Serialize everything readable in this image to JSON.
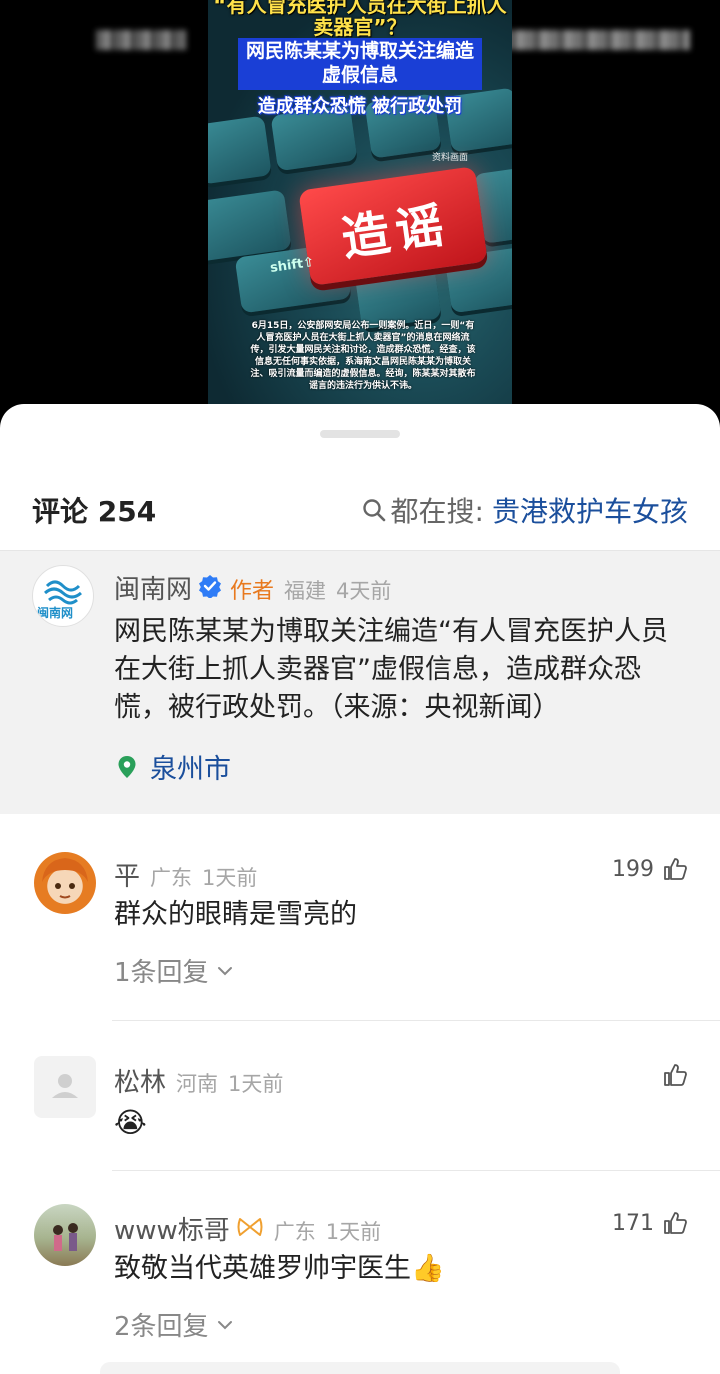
{
  "video": {
    "headline_top": "“有人冒充医护人员在大街上抓人卖器官”？",
    "headline_box": "网民陈某某为博取关注编造虚假信息",
    "headline_bottom": "造成群众恐慌 被行政处罚",
    "key_label": "造谣",
    "shift_label": "shift⇧",
    "watermark": "资料画面",
    "body_text": "6月15日，公安部网安局公布一则案例。近日，一则“有人冒充医护人员在大街上抓人卖器官”的消息在网络流传，引发大量网民关注和讨论，造成群众恐慌。经查，该信息无任何事实依据，系海南文昌网民陈某某为博取关注、吸引流量而编造的虚假信息。经询，陈某某对其散布谣言的违法行为供认不讳。"
  },
  "header": {
    "title": "评论 254",
    "search_prefix": "都在搜:",
    "search_term": "贵港救护车女孩"
  },
  "author_post": {
    "name": "闽南网",
    "badge": "作者",
    "region": "福建",
    "time": "4天前",
    "avatar_text": "闽南网",
    "content": "网民陈某某为博取关注编造“有人冒充医护人员在大街上抓人卖器官”虚假信息，造成群众恐慌，被行政处罚。（来源：央视新闻）",
    "location": "泉州市"
  },
  "comments": [
    {
      "name": "平",
      "region": "广东",
      "time": "1天前",
      "likes": "199",
      "text": "群众的眼睛是雪亮的",
      "replies": "1条回复"
    },
    {
      "name": "松林",
      "region": "河南",
      "time": "1天前",
      "likes": "",
      "text": "😭",
      "replies": ""
    },
    {
      "name": "www标哥",
      "region": "广东",
      "time": "1天前",
      "likes": "171",
      "text": "致敬当代英雄罗帅宇医生👍",
      "replies": "2条回复"
    }
  ],
  "colors": {
    "link_blue": "#1b4f9c",
    "author_orange": "#e8791e",
    "location_green": "#2aa05a",
    "verified_blue": "#2f7cf6"
  }
}
